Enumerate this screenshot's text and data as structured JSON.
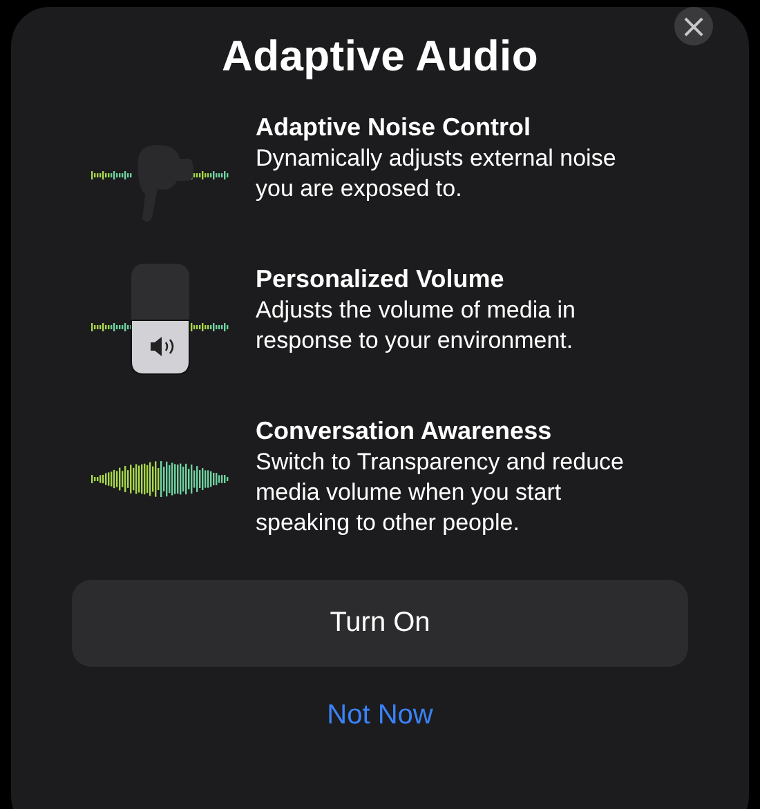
{
  "sheet": {
    "title": "Adaptive Audio",
    "close": "×"
  },
  "features": [
    {
      "kind": "earbud",
      "title": "Adaptive Noise Control",
      "description": "Dynamically adjusts external noise you are exposed to."
    },
    {
      "kind": "volume",
      "title": "Personalized Volume",
      "description": "Adjusts the volume of media in response to your environment."
    },
    {
      "kind": "wave",
      "title": "Conversation Awareness",
      "description": "Switch to Transparency and reduce media volume when you start speaking to other people."
    }
  ],
  "buttons": [
    {
      "kind": "primary",
      "label": "Turn On"
    },
    {
      "kind": "link",
      "label": "Not Now"
    }
  ]
}
